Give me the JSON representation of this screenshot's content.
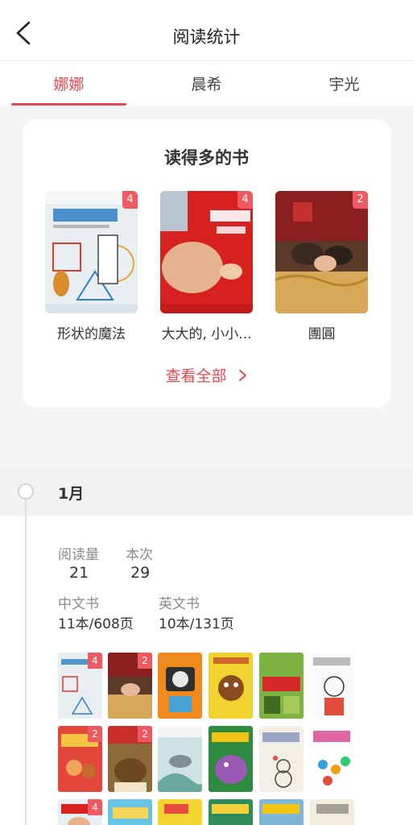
{
  "header": {
    "title": "阅读统计",
    "back_icon": "chevron-left-icon"
  },
  "tabs": [
    {
      "label": "娜娜",
      "active": true
    },
    {
      "label": "晨希",
      "active": false
    },
    {
      "label": "宇光",
      "active": false
    }
  ],
  "top_books": {
    "title": "读得多的书",
    "books": [
      {
        "title": "形状的魔法",
        "count": "4"
      },
      {
        "title": "大大的, 小小...",
        "count": "4"
      },
      {
        "title": "團圓",
        "count": "2"
      }
    ],
    "see_all": "查看全部"
  },
  "month": {
    "label": "1月",
    "stats": {
      "reads_label": "阅读量",
      "reads_value": "21",
      "sessions_label": "本次",
      "sessions_value": "29",
      "chinese_label": "中文书",
      "chinese_value": "11本/608页",
      "english_label": "英文书",
      "english_value": "10本/131页"
    },
    "thumbnail_badges": {
      "t1": "4",
      "t2": "2",
      "t7": "2",
      "t8": "2",
      "t13": "4"
    }
  },
  "colors": {
    "accent": "#e5484d",
    "badge": "#ee5a5f"
  }
}
